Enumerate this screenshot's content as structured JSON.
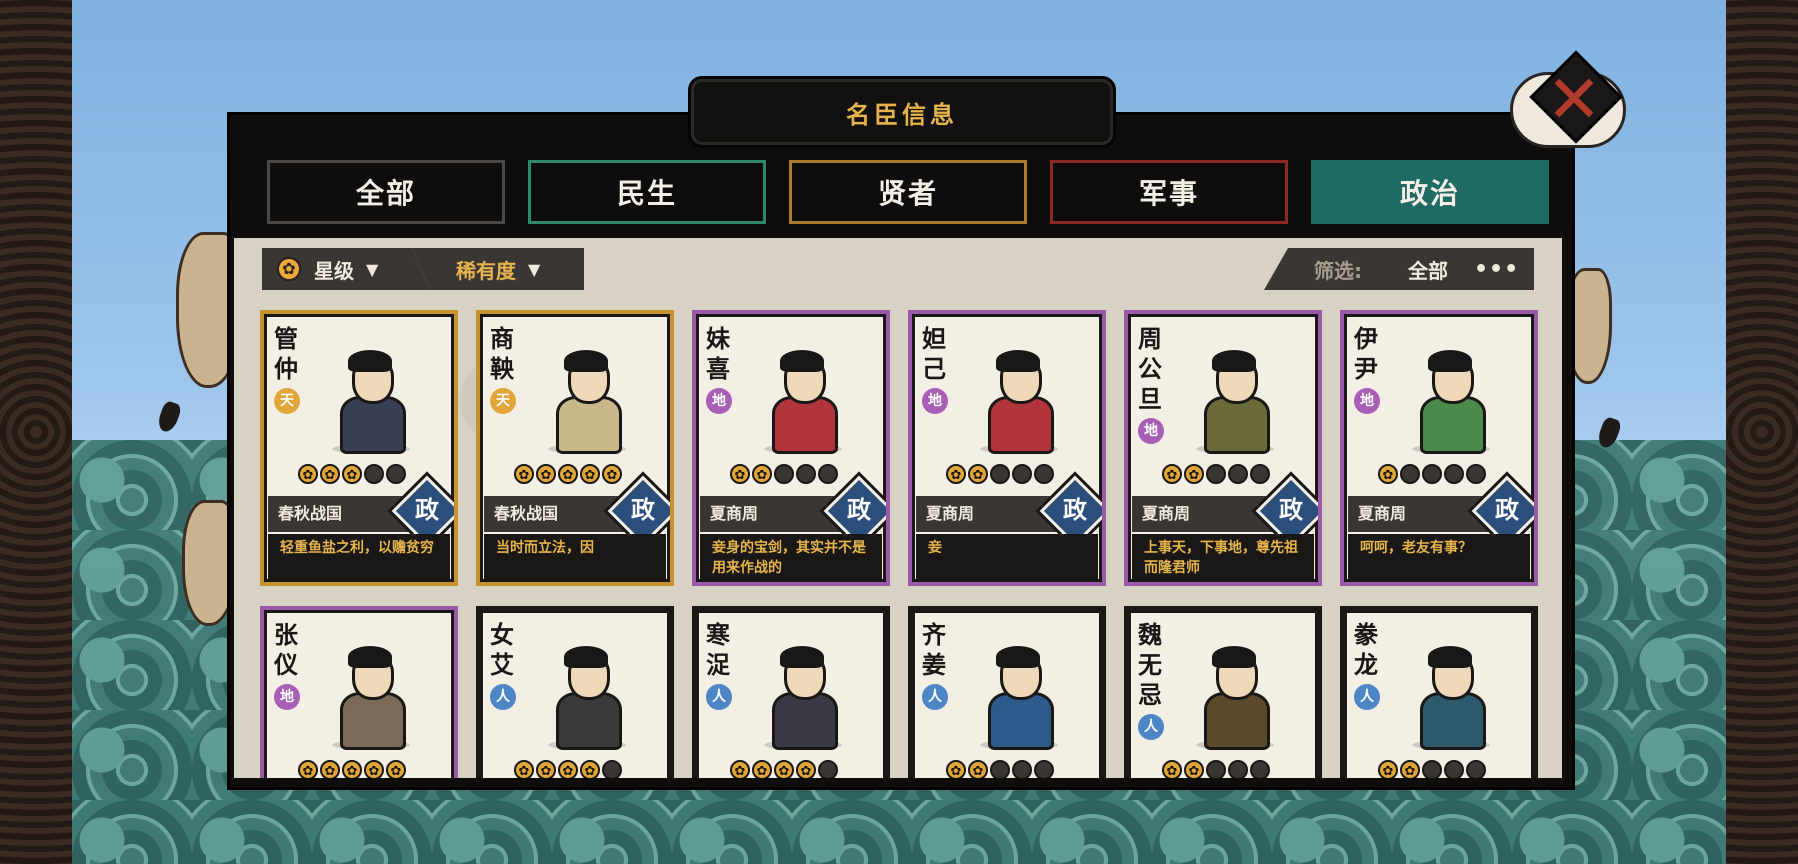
{
  "window": {
    "title": "名臣信息"
  },
  "close": {
    "icon": "close-x-icon",
    "glyph": "✕"
  },
  "tabs": [
    {
      "label": "全部",
      "color": "#4a4744"
    },
    {
      "label": "民生",
      "color": "#2e8a6a"
    },
    {
      "label": "贤者",
      "color": "#b07b2a"
    },
    {
      "label": "军事",
      "color": "#8a2a24"
    },
    {
      "label": "政治",
      "color": "#1f6a63",
      "active": true
    }
  ],
  "filters": {
    "sort_star": "星级",
    "sort_rarity": "稀有度",
    "filter_label": "筛选:",
    "filter_value": "全部",
    "more": "•••"
  },
  "badge_label": "政",
  "cards": [
    {
      "name": "管仲",
      "grade": "天",
      "grade_type": "tian",
      "frame": "gold",
      "stars": 3,
      "era": "春秋战国",
      "quote": "轻重鱼盐之利，以赡贫穷",
      "robe": "#3a3f55"
    },
    {
      "name": "商鞅",
      "grade": "天",
      "grade_type": "tian",
      "frame": "gold",
      "stars": 5,
      "era": "春秋战国",
      "quote": "当时而立法，因",
      "robe": "#c9b88a"
    },
    {
      "name": "妹喜",
      "grade": "地",
      "grade_type": "di",
      "frame": "purple",
      "stars": 2,
      "era": "夏商周",
      "quote": "妾身的宝剑，其实并不是用来作战的",
      "robe": "#b0343a"
    },
    {
      "name": "妲己",
      "grade": "地",
      "grade_type": "di",
      "frame": "purple",
      "stars": 2,
      "era": "夏商周",
      "quote": "妾",
      "robe": "#b0343a"
    },
    {
      "name": "周公旦",
      "grade": "地",
      "grade_type": "di",
      "frame": "purple",
      "stars": 2,
      "era": "夏商周",
      "quote": "上事天，下事地，尊先祖而隆君师",
      "robe": "#6a6a3a"
    },
    {
      "name": "伊尹",
      "grade": "地",
      "grade_type": "di",
      "frame": "purple",
      "stars": 1,
      "era": "夏商周",
      "quote": "呵呵，老友有事？",
      "robe": "#4a8a4a"
    },
    {
      "name": "张仪",
      "grade": "地",
      "grade_type": "di",
      "frame": "purple",
      "stars": 5,
      "era": "",
      "quote": "",
      "robe": "#7a6a5a"
    },
    {
      "name": "女艾",
      "grade": "人",
      "grade_type": "ren",
      "frame": "plain",
      "stars": 4,
      "era": "",
      "quote": "",
      "robe": "#3a3a3a"
    },
    {
      "name": "寒浞",
      "grade": "人",
      "grade_type": "ren",
      "frame": "plain",
      "stars": 4,
      "era": "",
      "quote": "",
      "robe": "#3a3a44"
    },
    {
      "name": "齐姜",
      "grade": "人",
      "grade_type": "ren",
      "frame": "plain",
      "stars": 2,
      "era": "",
      "quote": "",
      "robe": "#2c5a8a"
    },
    {
      "name": "魏无忌",
      "grade": "人",
      "grade_type": "ren",
      "frame": "plain",
      "stars": 2,
      "era": "",
      "quote": "",
      "robe": "#5a4a2a"
    },
    {
      "name": "豢龙",
      "grade": "人",
      "grade_type": "ren",
      "frame": "plain",
      "stars": 2,
      "era": "",
      "quote": "",
      "robe": "#2c5a6a"
    }
  ]
}
